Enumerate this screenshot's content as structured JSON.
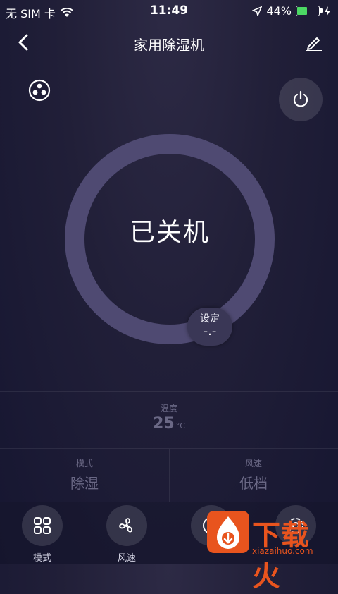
{
  "status": {
    "carrier": "无 SIM 卡",
    "time": "11:49",
    "battery": "44%",
    "battery_level": 0.44
  },
  "nav": {
    "title": "家用除湿机"
  },
  "dial": {
    "state": "已关机",
    "set_label": "设定",
    "set_value": "-.-"
  },
  "temperature": {
    "label": "温度",
    "value": "25",
    "unit": "°C"
  },
  "info": [
    {
      "label": "模式",
      "value": "除湿"
    },
    {
      "label": "风速",
      "value": "低档"
    }
  ],
  "bottom": [
    {
      "label": "模式",
      "icon": "grid-icon"
    },
    {
      "label": "风速",
      "icon": "fan-icon"
    },
    {
      "label": "",
      "icon": "timer-icon"
    },
    {
      "label": "",
      "icon": "settings-icon"
    }
  ],
  "watermark": {
    "text": "下载火",
    "url": "xiazaihuo.com"
  },
  "colors": {
    "ring": "#4f4a72",
    "accent": "#e8541e",
    "muted": "#6a6885"
  }
}
